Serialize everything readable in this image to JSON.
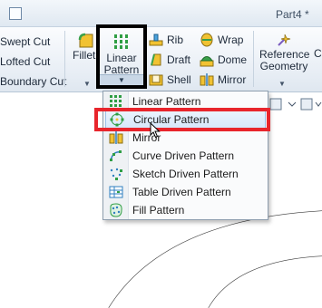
{
  "title": "Part4 *",
  "ribbon": {
    "swept_cut": "Swept Cut",
    "lofted_cut": "Lofted Cut",
    "boundary_cut": "Boundary Cut",
    "fillet": "Fillet",
    "linear_pattern_line1": "Linear",
    "linear_pattern_line2": "Pattern",
    "rib": "Rib",
    "draft": "Draft",
    "shell": "Shell",
    "wrap": "Wrap",
    "dome": "Dome",
    "mirror": "Mirror",
    "reference_geometry_line1": "Reference",
    "reference_geometry_line2": "Geometry",
    "c_cut": "C"
  },
  "menu": {
    "items": [
      {
        "label": "Linear Pattern",
        "icon": "linear-pattern-icon"
      },
      {
        "label": "Circular Pattern",
        "icon": "circular-pattern-icon",
        "highlighted": true
      },
      {
        "label": "Mirror",
        "icon": "mirror-icon"
      },
      {
        "label": "Curve Driven Pattern",
        "icon": "curve-driven-pattern-icon"
      },
      {
        "label": "Sketch Driven Pattern",
        "icon": "sketch-driven-pattern-icon"
      },
      {
        "label": "Table Driven Pattern",
        "icon": "table-driven-pattern-icon"
      },
      {
        "label": "Fill Pattern",
        "icon": "fill-pattern-icon"
      }
    ]
  },
  "colors": {
    "highlight_box": "#e8252c",
    "focus_box": "#000000",
    "menu_hover": "#d7e8fb"
  }
}
